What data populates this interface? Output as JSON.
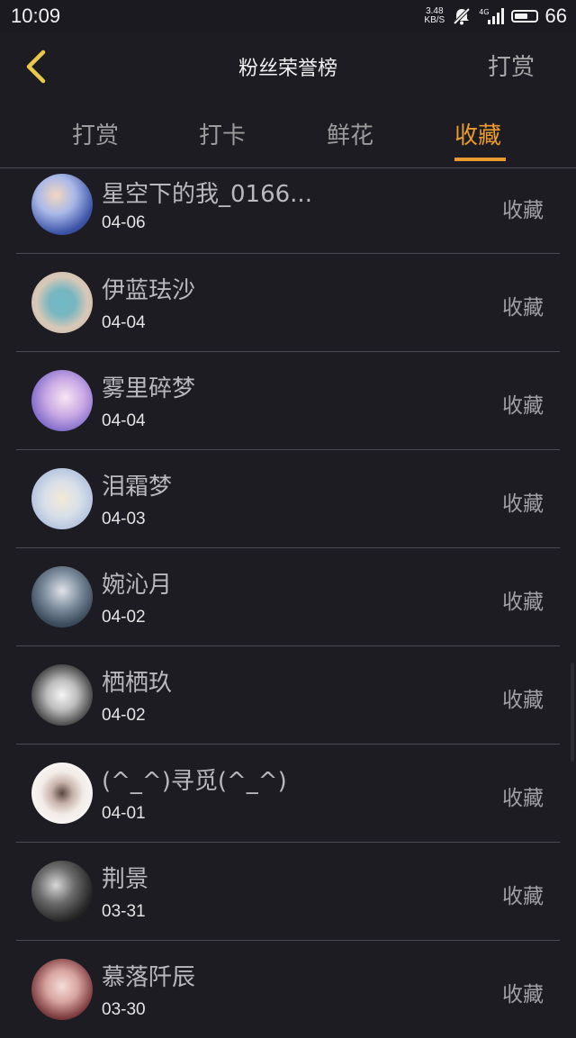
{
  "status_bar": {
    "time": "10:09",
    "net_speed_value": "3.48",
    "net_speed_unit": "KB/S",
    "network_type": "4G",
    "battery_level": "66"
  },
  "header": {
    "title": "粉丝荣誉榜",
    "action_label": "打赏"
  },
  "tabs": [
    {
      "label": "打赏",
      "active": false
    },
    {
      "label": "打卡",
      "active": false
    },
    {
      "label": "鲜花",
      "active": false
    },
    {
      "label": "收藏",
      "active": true
    }
  ],
  "colors": {
    "background": "#1c1c22",
    "accent": "#eb9a2f",
    "divider": "#4a4a52"
  },
  "list": [
    {
      "name": "星空下的我_0166...",
      "date": "04-06",
      "action": "收藏",
      "avatar": "avatar-image"
    },
    {
      "name": "伊蓝珐沙",
      "date": "04-04",
      "action": "收藏",
      "avatar": "avatar-image"
    },
    {
      "name": "雾里碎梦",
      "date": "04-04",
      "action": "收藏",
      "avatar": "avatar-image"
    },
    {
      "name": "泪霜梦",
      "date": "04-03",
      "action": "收藏",
      "avatar": "avatar-image"
    },
    {
      "name": "婉沁月",
      "date": "04-02",
      "action": "收藏",
      "avatar": "avatar-image"
    },
    {
      "name": "栖栖玖",
      "date": "04-02",
      "action": "收藏",
      "avatar": "avatar-image"
    },
    {
      "name": "(^_^)寻觅(^_^)",
      "date": "04-01",
      "action": "收藏",
      "avatar": "avatar-image"
    },
    {
      "name": "荆景",
      "date": "03-31",
      "action": "收藏",
      "avatar": "avatar-image"
    },
    {
      "name": "慕落阡辰",
      "date": "03-30",
      "action": "收藏",
      "avatar": "avatar-image"
    }
  ]
}
